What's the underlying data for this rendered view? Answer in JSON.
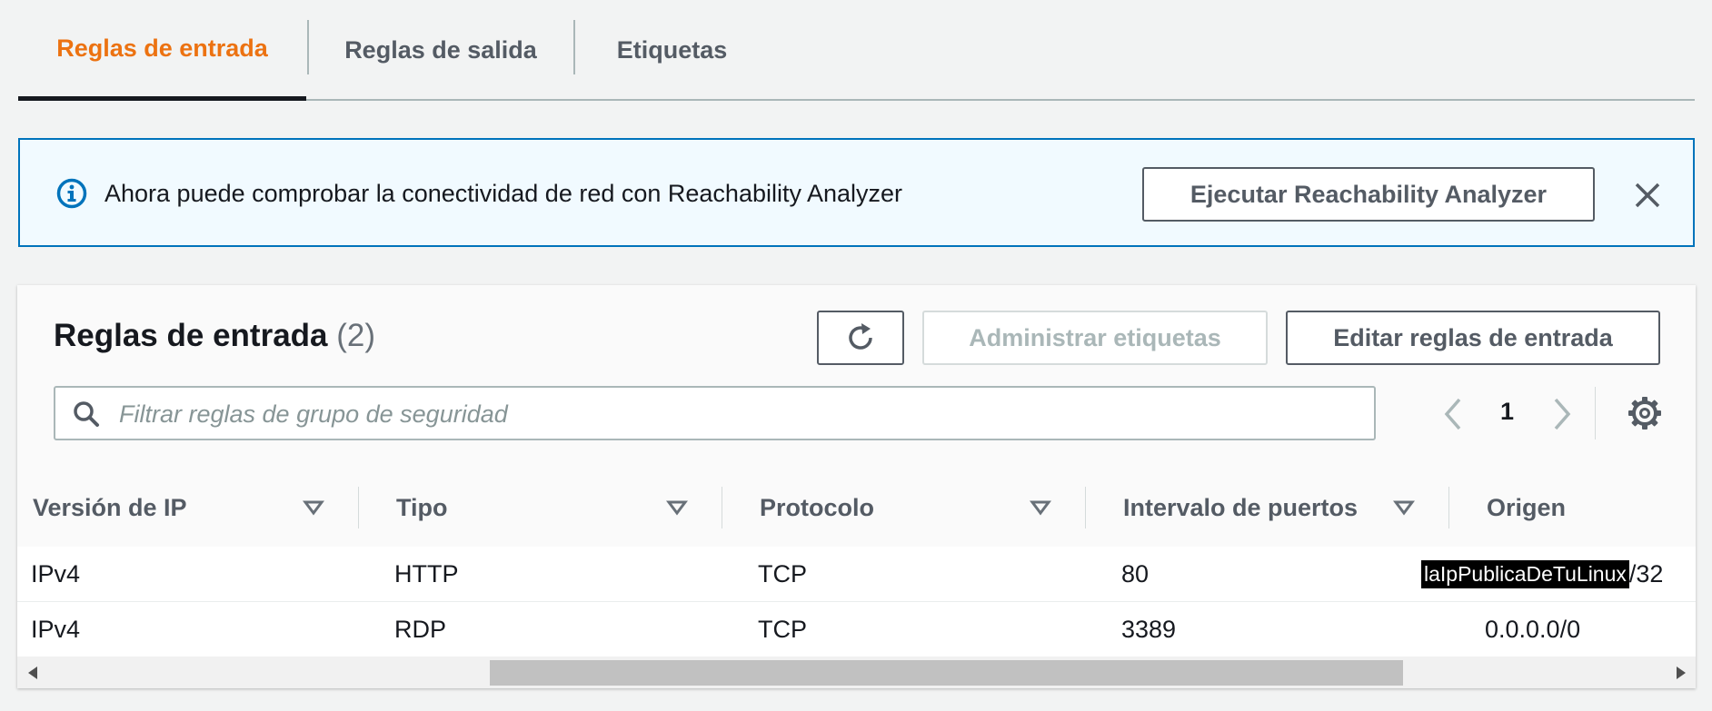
{
  "tabs": [
    {
      "label": "Reglas de entrada",
      "active": true
    },
    {
      "label": "Reglas de salida",
      "active": false
    },
    {
      "label": "Etiquetas",
      "active": false
    }
  ],
  "banner": {
    "icon": "info-icon",
    "text": "Ahora puede comprobar la conectividad de red con Reachability Analyzer",
    "button_label": "Ejecutar Reachability Analyzer",
    "close_icon": "close-icon"
  },
  "rules_panel": {
    "title": "Reglas de entrada",
    "count": "(2)",
    "refresh_icon": "refresh-icon",
    "manage_tags_label": "Administrar etiquetas",
    "edit_rules_label": "Editar reglas de entrada",
    "search": {
      "placeholder": "Filtrar reglas de grupo de seguridad",
      "value": ""
    },
    "pagination": {
      "current_page": "1"
    },
    "settings_icon": "gear-icon"
  },
  "table": {
    "columns": [
      "Versión de IP",
      "Tipo",
      "Protocolo",
      "Intervalo de puertos",
      "Origen"
    ],
    "rows": [
      {
        "ip_version": "IPv4",
        "type": "HTTP",
        "protocol": "TCP",
        "port_range": "80",
        "source_redacted": "laIpPublicaDeTuLinux",
        "source_suffix": "/32"
      },
      {
        "ip_version": "IPv4",
        "type": "RDP",
        "protocol": "TCP",
        "port_range": "3389",
        "source": "0.0.0.0/0"
      }
    ]
  },
  "colors": {
    "accent": "#ec7211",
    "info_blue": "#0073bb",
    "banner_bg": "#f1faff",
    "page_bg": "#f2f3f3"
  }
}
